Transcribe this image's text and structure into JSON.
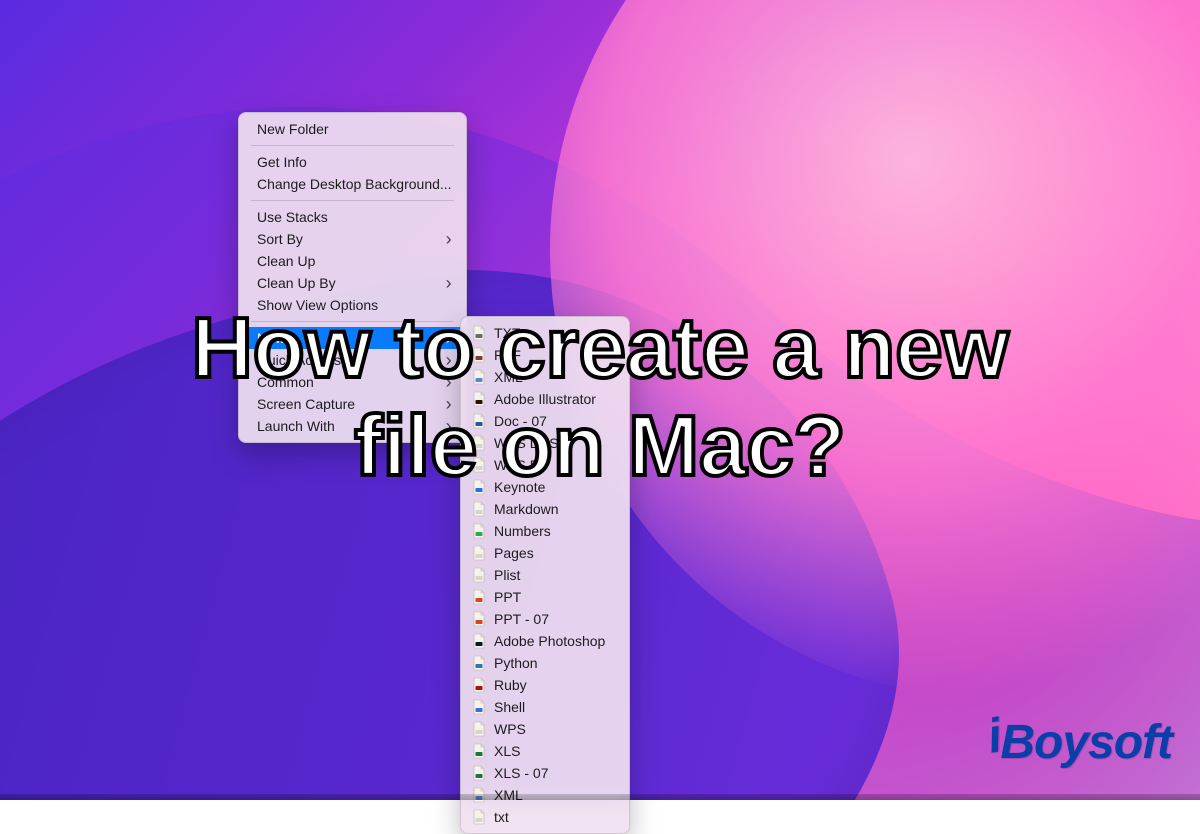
{
  "headline": "How to create a new\nfile on Mac?",
  "brand": "iBoysoft",
  "colors": {
    "menu_highlight": "#0a7aff",
    "brand_blue": "#0a3ea8"
  },
  "context_menu": {
    "groups": [
      [
        {
          "label": "New Folder",
          "submenu": false
        }
      ],
      [
        {
          "label": "Get Info",
          "submenu": false
        },
        {
          "label": "Change Desktop Background...",
          "submenu": false
        }
      ],
      [
        {
          "label": "Use Stacks",
          "submenu": false
        },
        {
          "label": "Sort By",
          "submenu": true
        },
        {
          "label": "Clean Up",
          "submenu": false
        },
        {
          "label": "Clean Up By",
          "submenu": true
        },
        {
          "label": "Show View Options",
          "submenu": false
        }
      ],
      [
        {
          "label": "New",
          "submenu": true,
          "highlighted": true
        },
        {
          "label": "Quick Access",
          "submenu": true
        },
        {
          "label": "Common",
          "submenu": true
        },
        {
          "label": "Screen Capture",
          "submenu": true
        },
        {
          "label": "Launch With",
          "submenu": true
        }
      ]
    ]
  },
  "submenu_new": {
    "items": [
      {
        "label": "TXT",
        "icon": "txt"
      },
      {
        "label": "RTF",
        "icon": "rtf"
      },
      {
        "label": "XML",
        "icon": "xml"
      },
      {
        "label": "Adobe Illustrator",
        "icon": "ai"
      },
      {
        "label": "Doc - 07",
        "icon": "docx"
      },
      {
        "label": "WPS DPS",
        "icon": "generic"
      },
      {
        "label": "WPS ET",
        "icon": "generic"
      },
      {
        "label": "Keynote",
        "icon": "keynote"
      },
      {
        "label": "Markdown",
        "icon": "generic"
      },
      {
        "label": "Numbers",
        "icon": "numbers"
      },
      {
        "label": "Pages",
        "icon": "generic"
      },
      {
        "label": "Plist",
        "icon": "generic"
      },
      {
        "label": "PPT",
        "icon": "ppt"
      },
      {
        "label": "PPT - 07",
        "icon": "pptx"
      },
      {
        "label": "Adobe Photoshop",
        "icon": "psd"
      },
      {
        "label": "Python",
        "icon": "python"
      },
      {
        "label": "Ruby",
        "icon": "ruby"
      },
      {
        "label": "Shell",
        "icon": "shell"
      },
      {
        "label": "WPS",
        "icon": "generic"
      },
      {
        "label": "XLS",
        "icon": "xls"
      },
      {
        "label": "XLS - 07",
        "icon": "xlsx"
      },
      {
        "label": "XML",
        "icon": "xml"
      },
      {
        "label": "txt",
        "icon": "generic"
      }
    ]
  }
}
